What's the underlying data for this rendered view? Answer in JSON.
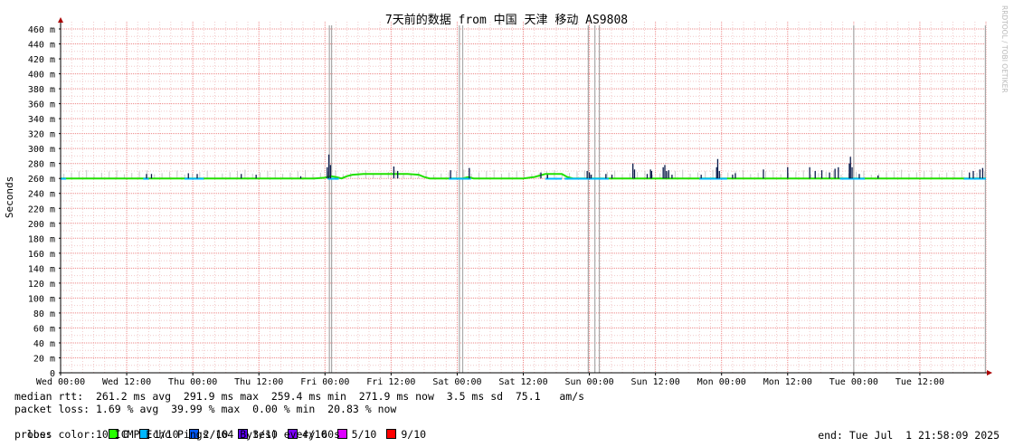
{
  "chart_data": {
    "type": "line",
    "title": "7天前的数据 from 中国 天津 移动 AS9808",
    "ylabel": "Seconds",
    "watermark": "RRDTOOL / TOBI OETIKER",
    "ylim": [
      0,
      460
    ],
    "y_ticks": [
      0,
      20,
      40,
      60,
      80,
      100,
      120,
      140,
      160,
      180,
      200,
      220,
      240,
      260,
      280,
      300,
      320,
      340,
      360,
      380,
      400,
      420,
      440,
      460
    ],
    "y_tick_labels": [
      "0",
      "20 m",
      "40 m",
      "60 m",
      "80 m",
      "100 m",
      "120 m",
      "140 m",
      "160 m",
      "180 m",
      "200 m",
      "220 m",
      "240 m",
      "260 m",
      "280 m",
      "300 m",
      "320 m",
      "340 m",
      "360 m",
      "380 m",
      "400 m",
      "420 m",
      "440 m",
      "460 m"
    ],
    "xlim_hours": [
      0,
      168
    ],
    "x_tick_labels": [
      "Wed 00:00",
      "Wed 12:00",
      "Thu 00:00",
      "Thu 12:00",
      "Fri 00:00",
      "Fri 12:00",
      "Sat 00:00",
      "Sat 12:00",
      "Sun 00:00",
      "Sun 12:00",
      "Mon 00:00",
      "Mon 12:00",
      "Tue 00:00",
      "Tue 12:00"
    ],
    "x_tick_hours": [
      0,
      12,
      24,
      36,
      48,
      60,
      72,
      84,
      96,
      108,
      120,
      132,
      144,
      156
    ],
    "grid": true,
    "series": [
      {
        "name": "median rtt",
        "points": [
          [
            0,
            260
          ],
          [
            10,
            260
          ],
          [
            14,
            260
          ],
          [
            18,
            260
          ],
          [
            22,
            260
          ],
          [
            26,
            260
          ],
          [
            30,
            260
          ],
          [
            34,
            260
          ],
          [
            38,
            260
          ],
          [
            42,
            260
          ],
          [
            46,
            260
          ],
          [
            48,
            261
          ],
          [
            49,
            263
          ],
          [
            50,
            262
          ],
          [
            51,
            260
          ],
          [
            52,
            263
          ],
          [
            53,
            265
          ],
          [
            55,
            266
          ],
          [
            57,
            266
          ],
          [
            59,
            266
          ],
          [
            61,
            266
          ],
          [
            63,
            266
          ],
          [
            65,
            265
          ],
          [
            66,
            262
          ],
          [
            67,
            260
          ],
          [
            70,
            260
          ],
          [
            73,
            260
          ],
          [
            74,
            262
          ],
          [
            75,
            260
          ],
          [
            80,
            260
          ],
          [
            84,
            260
          ],
          [
            86,
            262
          ],
          [
            88,
            266
          ],
          [
            91,
            266
          ],
          [
            92,
            262
          ],
          [
            93,
            260
          ],
          [
            96,
            260
          ],
          [
            98,
            260
          ],
          [
            100,
            260
          ],
          [
            102,
            260
          ],
          [
            106,
            260
          ],
          [
            110,
            260
          ],
          [
            114,
            260
          ],
          [
            118,
            260
          ],
          [
            122,
            260
          ],
          [
            126,
            260
          ],
          [
            130,
            260
          ],
          [
            134,
            260
          ],
          [
            138,
            260
          ],
          [
            142,
            260
          ],
          [
            146,
            260
          ],
          [
            150,
            260
          ],
          [
            154,
            260
          ],
          [
            158,
            260
          ],
          [
            162,
            260
          ],
          [
            166,
            260
          ],
          [
            168,
            260
          ]
        ]
      }
    ],
    "loss_segments": [
      {
        "x0": 0,
        "x1": 1,
        "loss": "1/10"
      },
      {
        "x0": 15,
        "x1": 16,
        "loss": "1/10"
      },
      {
        "x0": 22.5,
        "x1": 26,
        "loss": "1/10"
      },
      {
        "x0": 48.5,
        "x1": 50.5,
        "loss": "1/10"
      },
      {
        "x0": 70.5,
        "x1": 74.5,
        "loss": "1/10"
      },
      {
        "x0": 88,
        "x1": 91,
        "loss": "1/10"
      },
      {
        "x0": 91.5,
        "x1": 99.5,
        "loss": "1/10"
      },
      {
        "x0": 116,
        "x1": 121,
        "loss": "1/10"
      },
      {
        "x0": 141.5,
        "x1": 146,
        "loss": "1/10"
      },
      {
        "x0": 164,
        "x1": 168,
        "loss": "1/10"
      }
    ],
    "spikes": [
      [
        15.6,
        266
      ],
      [
        16.5,
        266
      ],
      [
        23.2,
        267
      ],
      [
        24.8,
        266
      ],
      [
        32.8,
        266
      ],
      [
        35.5,
        265
      ],
      [
        43.6,
        263
      ],
      [
        48.4,
        275
      ],
      [
        48.7,
        292
      ],
      [
        49.0,
        278
      ],
      [
        60.5,
        276
      ],
      [
        61.2,
        270
      ],
      [
        70.8,
        271
      ],
      [
        74.2,
        274
      ],
      [
        87.2,
        268
      ],
      [
        88.4,
        265
      ],
      [
        95.6,
        270
      ],
      [
        96.0,
        268
      ],
      [
        96.3,
        265
      ],
      [
        99.0,
        266
      ],
      [
        100.1,
        265
      ],
      [
        103.9,
        280
      ],
      [
        104.2,
        272
      ],
      [
        106.5,
        266
      ],
      [
        107.1,
        272
      ],
      [
        107.3,
        270
      ],
      [
        109.4,
        275
      ],
      [
        109.7,
        278
      ],
      [
        110.0,
        270
      ],
      [
        110.4,
        271
      ],
      [
        111.0,
        265
      ],
      [
        116.3,
        265
      ],
      [
        119.1,
        275
      ],
      [
        119.3,
        286
      ],
      [
        119.6,
        270
      ],
      [
        122.0,
        265
      ],
      [
        122.5,
        267
      ],
      [
        127.6,
        272
      ],
      [
        132.0,
        275
      ],
      [
        136.0,
        275
      ],
      [
        137.0,
        270
      ],
      [
        138.2,
        271
      ],
      [
        139.6,
        268
      ],
      [
        140.6,
        273
      ],
      [
        141.2,
        275
      ],
      [
        143.2,
        280
      ],
      [
        143.4,
        289
      ],
      [
        143.7,
        275
      ],
      [
        145.0,
        266
      ],
      [
        148.4,
        264
      ],
      [
        165.0,
        268
      ],
      [
        165.7,
        270
      ],
      [
        166.9,
        272
      ],
      [
        167.4,
        274
      ]
    ],
    "outages": [
      48.8,
      49.2,
      72.4,
      73.0,
      95.8,
      97.0,
      97.8,
      144.0,
      167.9
    ],
    "stats": {
      "median_rtt": "median rtt:  261.2 ms avg  291.9 ms max  259.4 ms min  271.9 ms now  3.5 ms sd  75.1   am/s",
      "packet_loss": "packet loss: 1.69 % avg  39.99 % max  0.00 % min  20.83 % now",
      "loss_color_label": "loss color:",
      "probe": "probe:       10 ICMP Echo Pings (64 Bytes) every 60s",
      "end": "end: Tue Jul  1 21:58:09 2025"
    },
    "loss_colors": [
      {
        "label": "0",
        "color": "#26ff00"
      },
      {
        "label": "1/10",
        "color": "#00b8ff"
      },
      {
        "label": "2/10",
        "color": "#0059ff"
      },
      {
        "label": "3/10",
        "color": "#5e00ff"
      },
      {
        "label": "4/10",
        "color": "#7e00ff"
      },
      {
        "label": "5/10",
        "color": "#dd00ff"
      },
      {
        "label": "9/10",
        "color": "#ff0000"
      }
    ]
  }
}
